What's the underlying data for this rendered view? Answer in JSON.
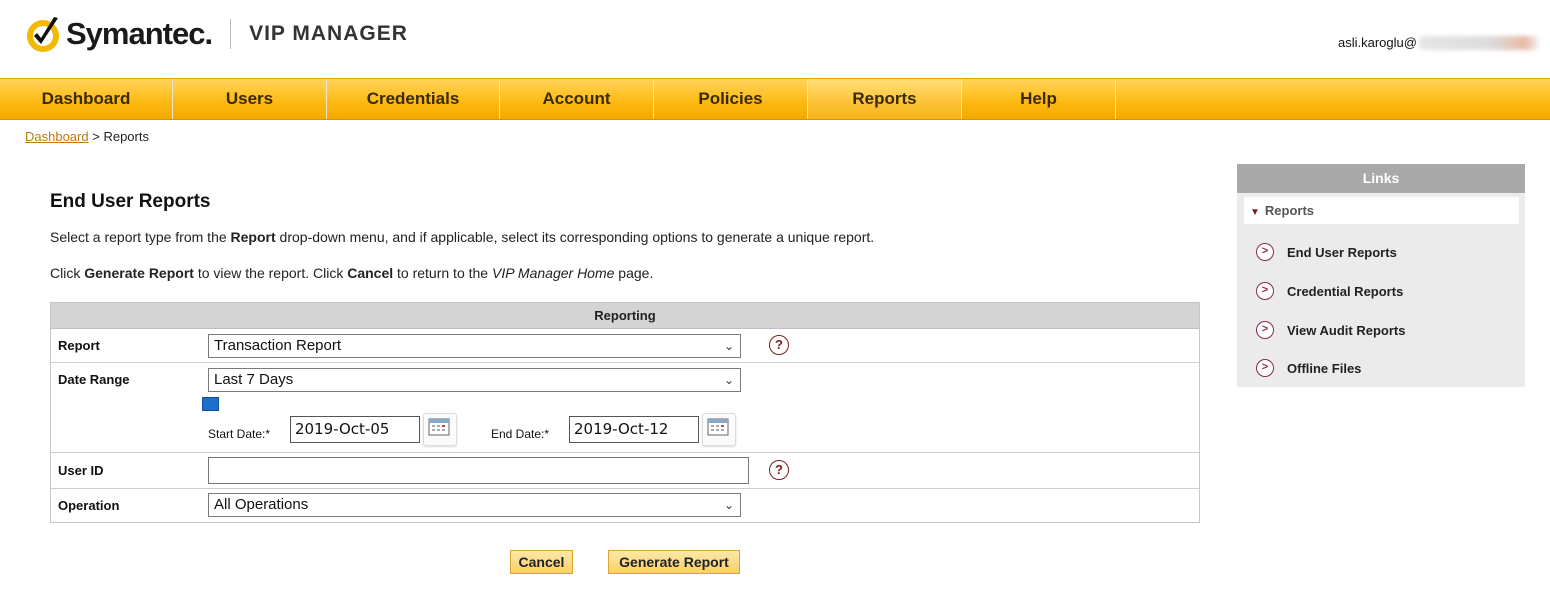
{
  "header": {
    "brand": "Symantec.",
    "product": "VIP MANAGER",
    "user": "asli.karoglu@"
  },
  "nav": {
    "items": [
      {
        "label": "Dashboard"
      },
      {
        "label": "Users"
      },
      {
        "label": "Credentials"
      },
      {
        "label": "Account"
      },
      {
        "label": "Policies"
      },
      {
        "label": "Reports",
        "active": true
      },
      {
        "label": "Help"
      }
    ]
  },
  "breadcrumb": {
    "home": "Dashboard",
    "separator": ">",
    "current": "Reports"
  },
  "main": {
    "title": "End User Reports",
    "desc1": {
      "part1": "Select a report type from the ",
      "bold1": "Report",
      "part2": " drop-down menu, and if applicable, select its corresponding options to generate a unique report."
    },
    "desc2": {
      "part1": "Click ",
      "bold1": "Generate Report",
      "part2": " to view the report. Click ",
      "bold2": "Cancel",
      "part3": " to return to the ",
      "italic1": "VIP Manager Home",
      "part4": " page."
    }
  },
  "form": {
    "header": "Reporting",
    "report_label": "Report",
    "report_value": "Transaction Report",
    "date_range_label": "Date Range",
    "date_range_value": "Last 7 Days",
    "start_label": "Start Date:*",
    "start_value": "2019-Oct-05",
    "end_label": "End Date:*",
    "end_value": "2019-Oct-12",
    "user_id_label": "User ID",
    "user_id_value": "",
    "operation_label": "Operation",
    "operation_value": "All Operations",
    "help_glyph": "?"
  },
  "buttons": {
    "cancel": "Cancel",
    "generate": "Generate Report"
  },
  "links": {
    "title": "Links",
    "section": "Reports",
    "items": [
      {
        "label": "End User Reports"
      },
      {
        "label": "Credential Reports"
      },
      {
        "label": "View Audit Reports"
      },
      {
        "label": "Offline Files"
      }
    ]
  },
  "colors": {
    "nav_gold": "#fdbb15",
    "link_accent": "#c07810",
    "help_maroon": "#7a1f1f",
    "date_marker_blue": "#1d6fcc"
  },
  "icons": {
    "logo": "symantec-checkmark-logo",
    "help": "question-circle-icon",
    "calendar": "calendar-icon",
    "link_arrow": "chevron-right-circle-icon",
    "section_toggle": "triangle-down-icon",
    "select_arrow": "chevron-down-icon"
  }
}
